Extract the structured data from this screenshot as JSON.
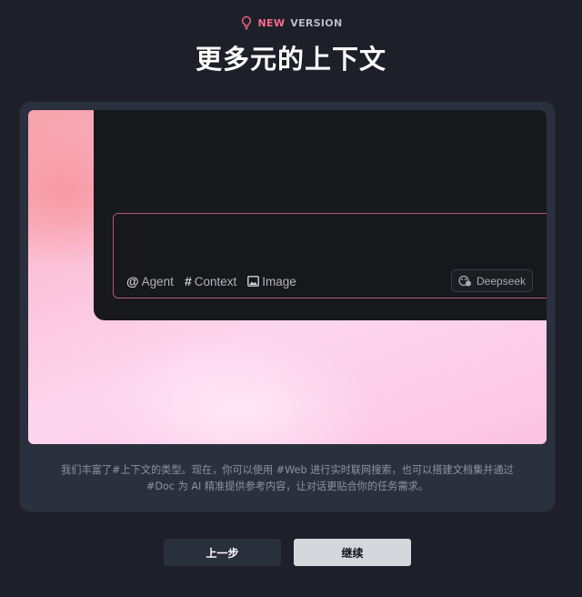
{
  "badge": {
    "icon": "lightbulb-icon",
    "new_label": "NEW",
    "version_label": "VERSION"
  },
  "title": "更多元的上下文",
  "preview": {
    "chips": [
      {
        "icon": "at-icon",
        "symbol": "@",
        "label": "Agent"
      },
      {
        "icon": "hash-icon",
        "symbol": "#",
        "label": "Context"
      },
      {
        "icon": "image-icon",
        "symbol": "",
        "label": "Image"
      }
    ],
    "model": {
      "icon": "model-icon",
      "label": "Deepseek"
    }
  },
  "description": {
    "line1": "我们丰富了#上下文的类型。现在，你可以使用 #Web 进行实时联网搜索，也可以搭建文档集并通过",
    "line2": "#Doc 为 AI 精准提供参考内容，让对话更贴合你的任务需求。"
  },
  "buttons": {
    "prev_label": "上一步",
    "next_label": "继续"
  },
  "colors": {
    "background": "#1d2029",
    "card": "#2b303e",
    "accent": "#ff6a8a",
    "composer_border": "#b75679"
  }
}
